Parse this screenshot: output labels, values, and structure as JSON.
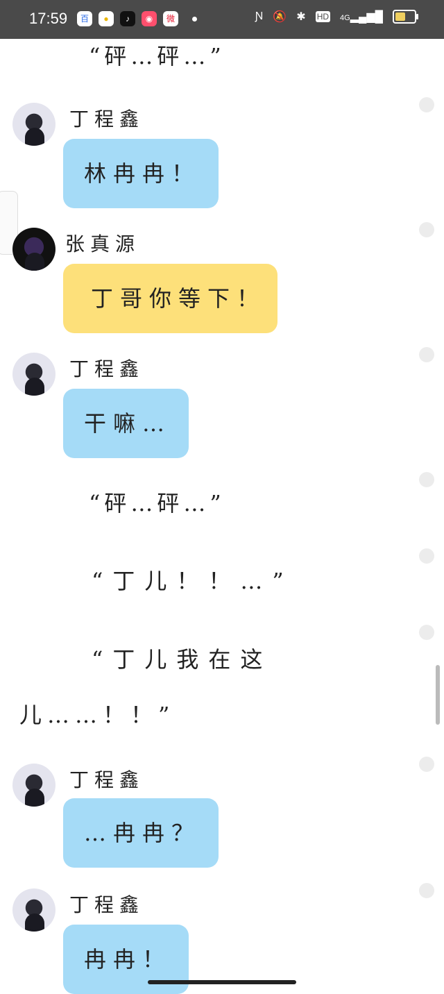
{
  "status_bar": {
    "time": "17:59",
    "app_icons": [
      "baidu-app-icon",
      "qq-browser-icon",
      "tiktok-icon",
      "kuaishou-icon",
      "weibo-icon"
    ],
    "network": "4G",
    "hd_label": "HD"
  },
  "messages": [
    {
      "type": "narration",
      "text": "“砰…砰…”"
    },
    {
      "type": "chat",
      "speaker": "丁程鑫",
      "text": "林冉冉！",
      "bubble_color": "#a5dbf7"
    },
    {
      "type": "chat",
      "speaker": "张真源",
      "text": "丁哥你等下！",
      "bubble_color": "#fde07a"
    },
    {
      "type": "chat",
      "speaker": "丁程鑫",
      "text": "干嘛…",
      "bubble_color": "#a5dbf7"
    },
    {
      "type": "narration",
      "text": "“砰…砰…”"
    },
    {
      "type": "narration",
      "text": "“丁儿！！…”"
    },
    {
      "type": "narration",
      "text": "“丁儿我在这"
    },
    {
      "type": "narration",
      "text": "儿……！！”"
    },
    {
      "type": "chat",
      "speaker": "丁程鑫",
      "text": "…冉冉？",
      "bubble_color": "#a5dbf7"
    },
    {
      "type": "chat",
      "speaker": "丁程鑫",
      "text": "冉冉！",
      "bubble_color": "#a5dbf7"
    }
  ],
  "colors": {
    "status_bar_bg": "#4a4a4a",
    "ding_bubble": "#a5dbf7",
    "zhang_bubble": "#fde07a"
  }
}
